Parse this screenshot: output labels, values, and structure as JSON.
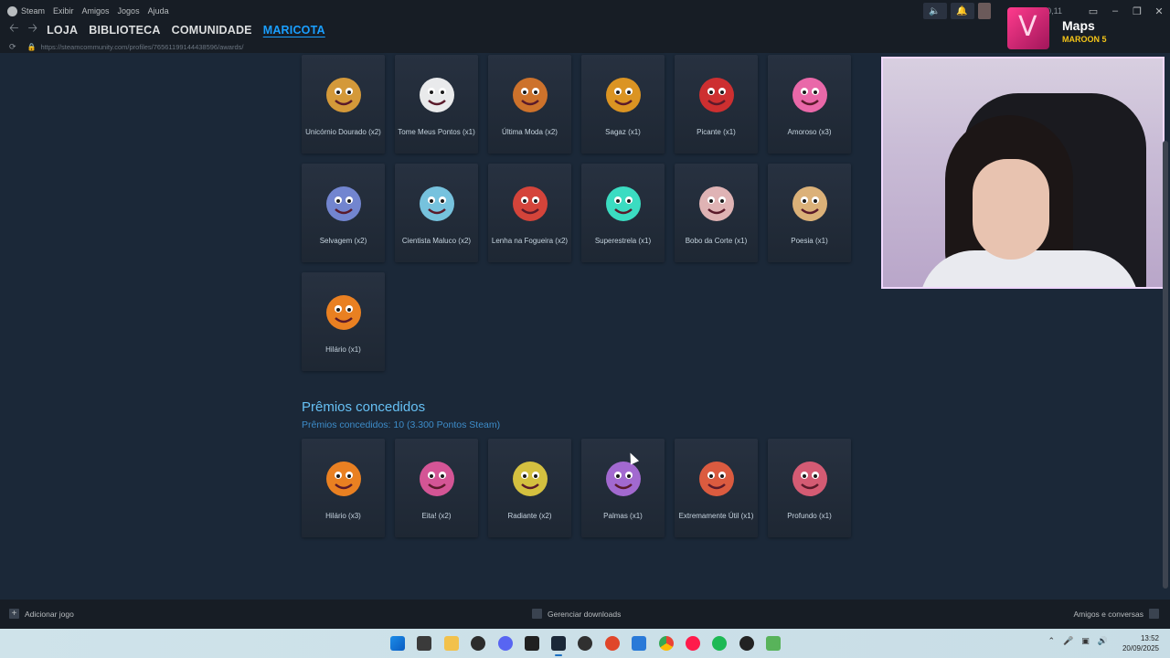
{
  "menu": {
    "app_name": "Steam",
    "items": [
      "Exibir",
      "Amigos",
      "Jogos",
      "Ajuda"
    ],
    "balance": "R$0,11"
  },
  "nav": {
    "tabs": [
      "LOJA",
      "BIBLIOTECA",
      "COMUNIDADE",
      "MARICOTA"
    ],
    "active_tab": "MARICOTA"
  },
  "url": "https://steamcommunity.com/profiles/76561199144438596/awards/",
  "now_playing": {
    "title": "Maps",
    "artist": "MAROON 5"
  },
  "received_awards": [
    {
      "label": "Unicórnio Dourado (x2)",
      "icon": "golden-unicorn-icon",
      "color": "#e8a53a"
    },
    {
      "label": "Tome Meus Pontos (x1)",
      "icon": "winged-coin-icon",
      "color": "#ffffff"
    },
    {
      "label": "Última Moda (x2)",
      "icon": "fashion-shoe-icon",
      "color": "#e07a2a"
    },
    {
      "label": "Sagaz (x1)",
      "icon": "smart-dinosaur-icon",
      "color": "#f0a020"
    },
    {
      "label": "Picante (x1)",
      "icon": "hot-sauce-icon",
      "color": "#e03030"
    },
    {
      "label": "Amoroso (x3)",
      "icon": "pink-heart-icon",
      "color": "#ff6fb5"
    },
    {
      "label": "Selvagem (x2)",
      "icon": "jaguar-icon",
      "color": "#7b8fe0"
    },
    {
      "label": "Cientista Maluco (x2)",
      "icon": "plasma-ball-icon",
      "color": "#7fd3f0"
    },
    {
      "label": "Lenha na Fogueira (x2)",
      "icon": "rooster-icon",
      "color": "#e8473b"
    },
    {
      "label": "Superestrela (x1)",
      "icon": "shooting-star-icon",
      "color": "#3ef0d0"
    },
    {
      "label": "Bobo da Corte (x1)",
      "icon": "clown-icon",
      "color": "#f4c2c2"
    },
    {
      "label": "Poesia (x1)",
      "icon": "poetry-scroll-icon",
      "color": "#f0c080"
    },
    {
      "label": "Hilário (x1)",
      "icon": "laughing-face-icon",
      "color": "#ff8a1f"
    }
  ],
  "given": {
    "title": "Prêmios concedidos",
    "subtitle": "Prêmios concedidos: 10 (3.300 Pontos Steam)"
  },
  "given_awards": [
    {
      "label": "Hilário (x3)",
      "icon": "laughing-face-icon",
      "color": "#ff8a1f"
    },
    {
      "label": "Eita! (x2)",
      "icon": "wow-face-icon",
      "color": "#e85aa0"
    },
    {
      "label": "Radiante (x2)",
      "icon": "radiant-orb-icon",
      "color": "#e8d040"
    },
    {
      "label": "Palmas (x1)",
      "icon": "clapping-hands-icon",
      "color": "#b070e0"
    },
    {
      "label": "Extremamente Útil (x1)",
      "icon": "helpful-hands-icon",
      "color": "#f06040"
    },
    {
      "label": "Profundo (x1)",
      "icon": "deep-brain-icon",
      "color": "#e8607a"
    }
  ],
  "bottom": {
    "add_game": "Adicionar jogo",
    "downloads": "Gerenciar downloads",
    "friends": "Amigos e conversas"
  },
  "clock": {
    "time": "13:52",
    "date": "20/09/2025"
  }
}
